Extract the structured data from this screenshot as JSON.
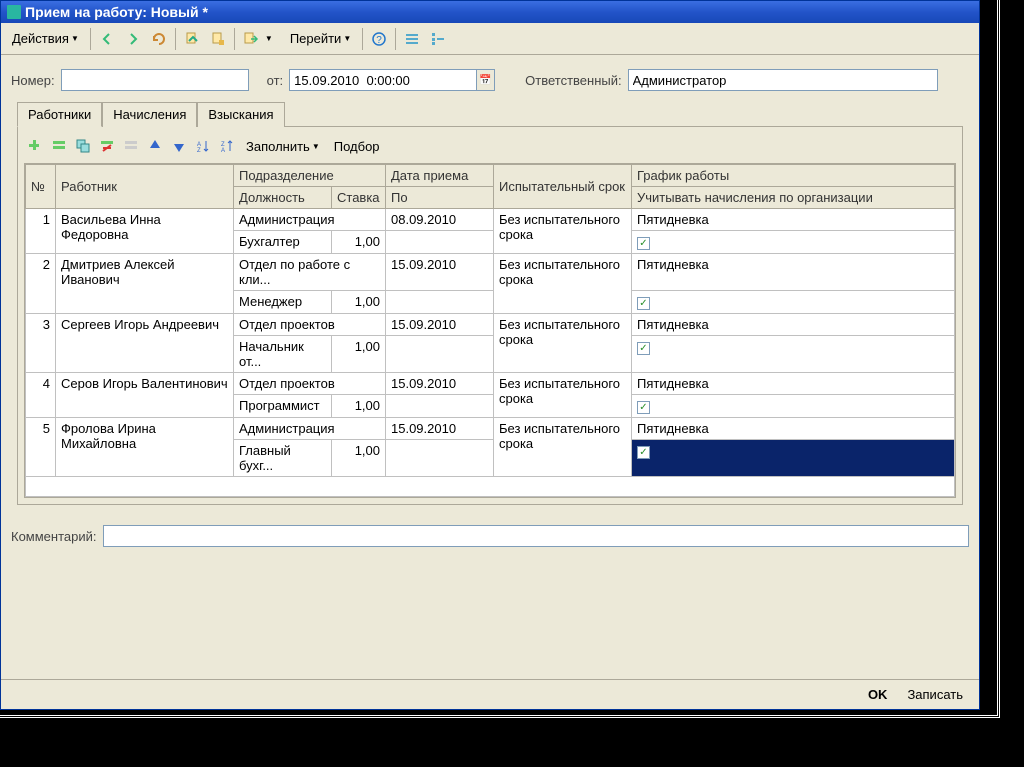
{
  "window": {
    "title": "Прием на работу: Новый *"
  },
  "toolbar": {
    "actions": "Действия",
    "goto": "Перейти"
  },
  "form": {
    "number_label": "Номер:",
    "number_value": "",
    "date_label": "от:",
    "date_value": "15.09.2010  0:00:00",
    "responsible_label": "Ответственный:",
    "responsible_value": "Администратор"
  },
  "tabs": {
    "employees": "Работники",
    "accruals": "Начисления",
    "deductions": "Взыскания"
  },
  "subtoolbar": {
    "fill": "Заполнить",
    "pick": "Подбор"
  },
  "grid": {
    "headers": {
      "num": "№",
      "employee": "Работник",
      "department": "Подразделение",
      "position": "Должность",
      "rate": "Ставка",
      "hire_date": "Дата приема",
      "hire_date_sub": "По",
      "probation": "Испытательный срок",
      "schedule": "График работы",
      "schedule_sub": "Учитывать начисления по организации"
    },
    "rows": [
      {
        "n": "1",
        "employee": "Васильева Инна Федоровна",
        "dept": "Администрация",
        "pos": "Бухгалтер",
        "rate": "1,00",
        "date": "08.09.2010",
        "prob": "Без испытательного срока",
        "sched": "Пятидневка",
        "chk": true
      },
      {
        "n": "2",
        "employee": "Дмитриев Алексей Иванович",
        "dept": "Отдел по работе с кли...",
        "pos": "Менеджер",
        "rate": "1,00",
        "date": "15.09.2010",
        "prob": "Без испытательного срока",
        "sched": "Пятидневка",
        "chk": true
      },
      {
        "n": "3",
        "employee": "Сергеев Игорь Андреевич",
        "dept": "Отдел проектов",
        "pos": "Начальник от...",
        "rate": "1,00",
        "date": "15.09.2010",
        "prob": "Без испытательного срока",
        "sched": "Пятидневка",
        "chk": true
      },
      {
        "n": "4",
        "employee": "Серов Игорь Валентинович",
        "dept": "Отдел проектов",
        "pos": "Программист",
        "rate": "1,00",
        "date": "15.09.2010",
        "prob": "Без испытательного срока",
        "sched": "Пятидневка",
        "chk": true
      },
      {
        "n": "5",
        "employee": "Фролова Ирина Михайловна",
        "dept": "Администрация",
        "pos": "Главный бухг...",
        "rate": "1,00",
        "date": "15.09.2010",
        "prob": "Без испытательного срока",
        "sched": "Пятидневка",
        "chk": true,
        "selected": true
      }
    ]
  },
  "comment_label": "Комментарий:",
  "comment_value": "",
  "footer": {
    "ok": "OK",
    "save": "Записать"
  }
}
